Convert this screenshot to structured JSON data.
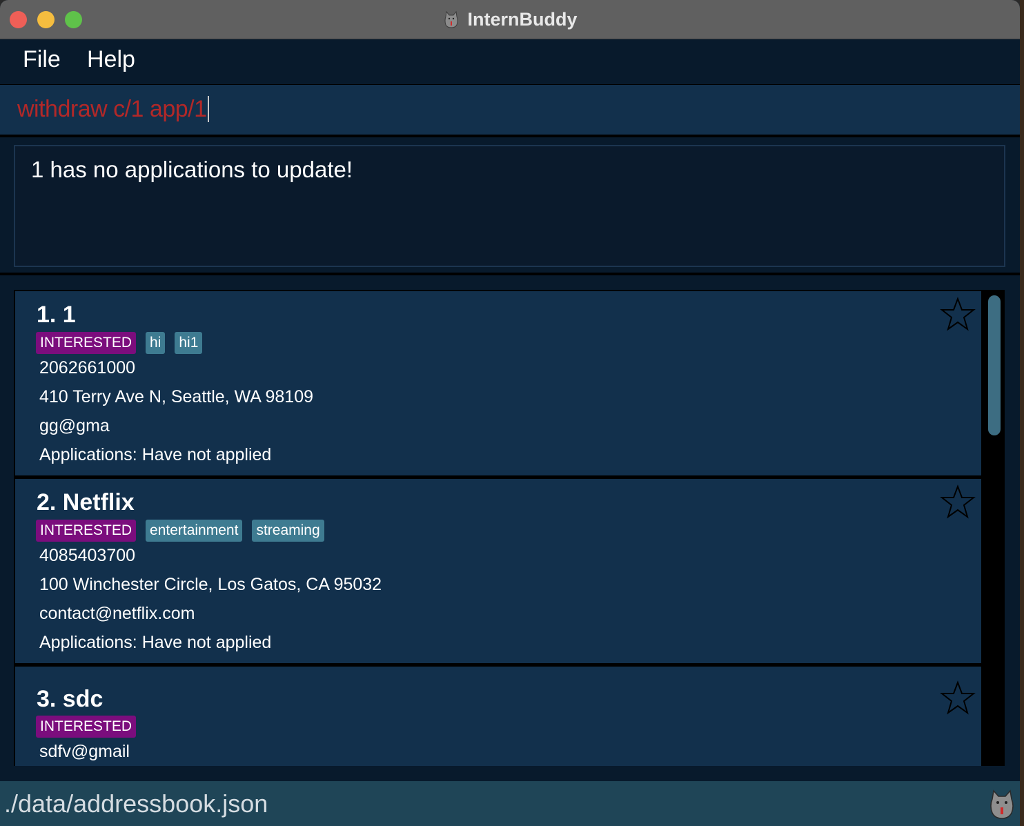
{
  "window": {
    "title": "InternBuddy"
  },
  "menu": {
    "file": "File",
    "help": "Help"
  },
  "command": {
    "value": "withdraw c/1 app/1"
  },
  "result": {
    "message": "1 has no applications to update!"
  },
  "companies": [
    {
      "title": "1. 1",
      "status": "INTERESTED",
      "tags": [
        "hi",
        "hi1"
      ],
      "phone": "2062661000",
      "address": "410 Terry Ave N, Seattle, WA 98109",
      "email": "gg@gma",
      "applications": "Applications: Have not applied"
    },
    {
      "title": "2. Netflix",
      "status": "INTERESTED",
      "tags": [
        "entertainment",
        "streaming"
      ],
      "phone": "4085403700",
      "address": "100 Winchester Circle, Los Gatos, CA 95032",
      "email": "contact@netflix.com",
      "applications": "Applications: Have not applied"
    },
    {
      "title": "3. sdc",
      "status": "INTERESTED",
      "email": "sdfv@gmail"
    }
  ],
  "status_bar": {
    "file_path": "./data/addressbook.json"
  },
  "colors": {
    "background": "#081a2c",
    "card": "#12304c",
    "status_tag": "#7b0d7d",
    "tag": "#3e7b91",
    "command_text": "#b22828",
    "status_bar": "#1f4557"
  },
  "icons": {
    "favourite": "star-outline-icon",
    "app": "cat-mascot-icon"
  }
}
